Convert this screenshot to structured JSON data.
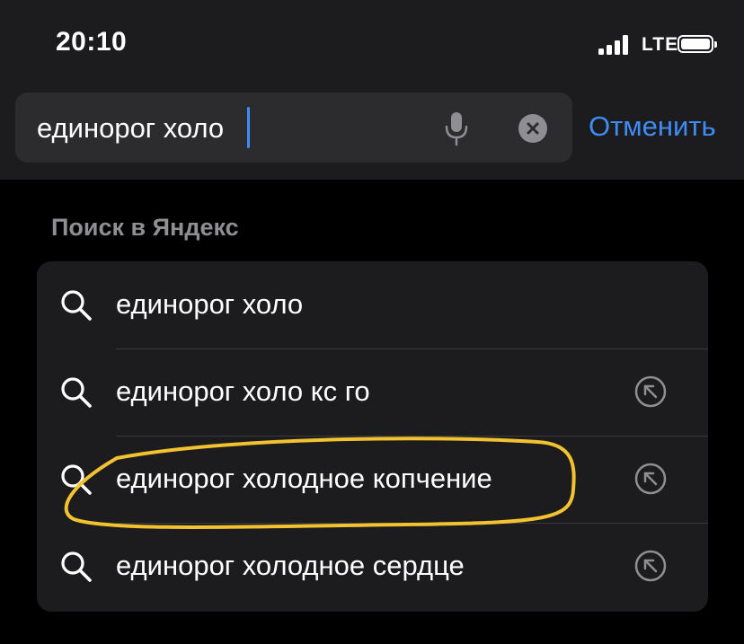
{
  "status_bar": {
    "time": "20:10",
    "network": "LTE"
  },
  "search": {
    "query": "единорог холо",
    "cancel_label": "Отменить"
  },
  "section": {
    "title": "Поиск в Яндекс"
  },
  "suggestions": [
    {
      "text": "единорог холо",
      "has_fill_arrow": false
    },
    {
      "text": "единорог холо кс го",
      "has_fill_arrow": true
    },
    {
      "text": "единорог холодное копчение",
      "has_fill_arrow": true,
      "highlighted": true
    },
    {
      "text": "единорог холодное сердце",
      "has_fill_arrow": true
    }
  ],
  "colors": {
    "accent": "#3e8df7",
    "highlight": "#f2c230",
    "secondary_text": "#8e8e93"
  },
  "icons": {
    "search_icon": "search-icon",
    "mic_icon": "microphone-icon",
    "clear_icon": "clear-icon",
    "fill_icon": "arrow-up-left-icon"
  }
}
